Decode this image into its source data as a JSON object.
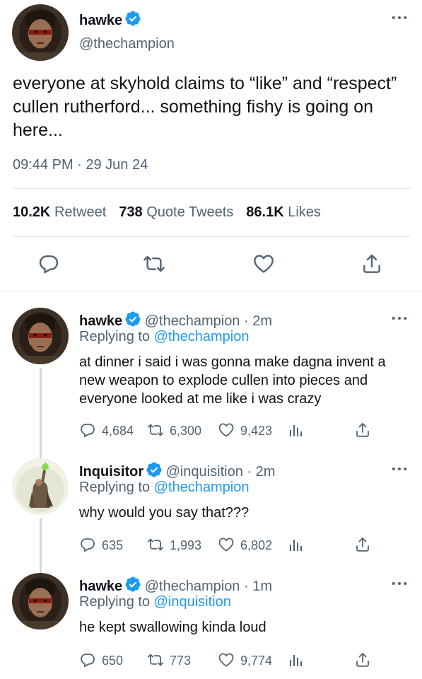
{
  "colors": {
    "verified": "#1d9bf0",
    "link": "#1d9bf0",
    "secondary_text": "#536471",
    "divider": "#e6e9eb",
    "thread_line": "#cfd9de"
  },
  "main_tweet": {
    "name": "hawke",
    "handle": "@thechampion",
    "text": "everyone at skyhold claims to “like” and “respect” cullen rutherford... something fishy is going on here...",
    "timestamp": "09:44 PM · 29 Jun 24",
    "stats": {
      "retweets_count": "10.2K",
      "retweets_label": "Retweet",
      "quotes_count": "738",
      "quotes_label": "Quote Tweets",
      "likes_count": "86.1K",
      "likes_label": "Likes"
    },
    "icons": [
      "reply-icon",
      "retweet-icon",
      "like-icon",
      "share-icon",
      "more-icon"
    ]
  },
  "replies": [
    {
      "name": "hawke",
      "meta": "@thechampion · 2m",
      "replying_prefix": "Replying to",
      "replying_to": "@thechampion",
      "text": "at dinner i said i was gonna make dagna invent a new weapon to explode cullen into pieces and everyone looked at me like i was crazy",
      "replies": "4,684",
      "retweets": "6,300",
      "likes": "9,423"
    },
    {
      "name": "Inquisitor",
      "meta": "@inquisition · 2m",
      "replying_prefix": "Replying to",
      "replying_to": "@thechampion",
      "text": "why would you say that???",
      "replies": "635",
      "retweets": "1,993",
      "likes": "6,802"
    },
    {
      "name": "hawke",
      "meta": "@thechampion · 1m",
      "replying_prefix": "Replying to",
      "replying_to": "@inquisition",
      "text": "he kept swallowing kinda loud",
      "replies": "650",
      "retweets": "773",
      "likes": "9,774"
    }
  ]
}
